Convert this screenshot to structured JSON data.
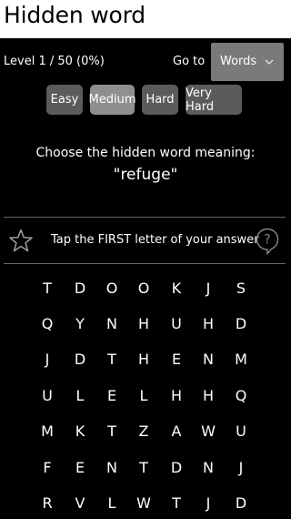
{
  "app": {
    "title": "Hidden word"
  },
  "level": {
    "text": "Level 1 / 50 (0%)",
    "goto_label": "Go to",
    "goto_value": "Words"
  },
  "difficulty": {
    "options": [
      "Easy",
      "Medium",
      "Hard",
      "Very Hard"
    ],
    "selected": "Medium"
  },
  "question": {
    "prompt": "Choose the hidden word meaning:",
    "word": "\"refuge\""
  },
  "hint": {
    "text": "Tap the FIRST letter of your answer"
  },
  "icons": {
    "favorite": "star-icon",
    "help": "question-bubble-icon",
    "dropdown": "chevron-down-icon"
  },
  "colors": {
    "background": "#000000",
    "button": "#5b5b5b",
    "button_active": "#8f8f8f",
    "select": "#7a7a7a"
  },
  "grid": {
    "rows": [
      [
        "T",
        "D",
        "O",
        "O",
        "K",
        "J",
        "S"
      ],
      [
        "Q",
        "Y",
        "N",
        "H",
        "U",
        "H",
        "D"
      ],
      [
        "J",
        "D",
        "T",
        "H",
        "E",
        "N",
        "M"
      ],
      [
        "U",
        "L",
        "E",
        "L",
        "H",
        "H",
        "Q"
      ],
      [
        "M",
        "K",
        "T",
        "Z",
        "A",
        "W",
        "U"
      ],
      [
        "F",
        "E",
        "N",
        "T",
        "D",
        "N",
        "J"
      ],
      [
        "R",
        "V",
        "L",
        "W",
        "T",
        "J",
        "D"
      ]
    ]
  }
}
